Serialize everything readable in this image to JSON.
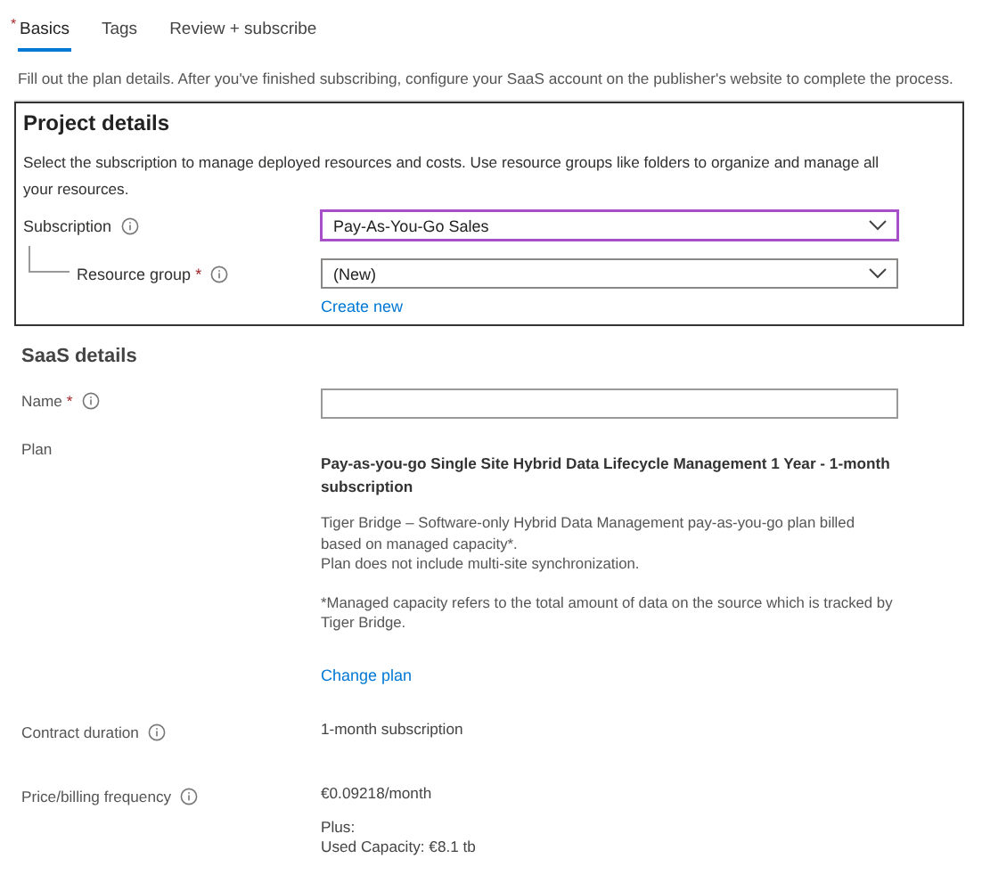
{
  "tabs": [
    {
      "label": "Basics",
      "selected": true,
      "required_mark": "*"
    },
    {
      "label": "Tags",
      "selected": false
    },
    {
      "label": "Review + subscribe",
      "selected": false
    }
  ],
  "intro": "Fill out the plan details. After you've finished subscribing, configure your SaaS account on the publisher's website to complete the process.",
  "project_details": {
    "title": "Project details",
    "description": "Select the subscription to manage deployed resources and costs. Use resource groups like folders to organize and manage all your resources.",
    "fields": [
      {
        "kind": "dropdown",
        "label": "Subscription",
        "info": true,
        "nested": false,
        "value": "Pay-As-You-Go Sales",
        "focused": true
      },
      {
        "kind": "dropdown",
        "label": "Resource group",
        "required_mark": "*",
        "info": true,
        "nested": true,
        "value": "(New)",
        "focused": false,
        "link": "Create new"
      }
    ]
  },
  "saas_details": {
    "title": "SaaS details",
    "fields": [
      {
        "kind": "input",
        "label": "Name",
        "required_mark": "*",
        "info": true
      },
      {
        "kind": "plan",
        "label": "Plan",
        "plan_title": "Pay-as-you-go Single Site Hybrid Data Lifecycle Management 1 Year - 1-month subscription",
        "paragraphs": [
          "Tiger Bridge – Software-only Hybrid Data Management pay-as-you-go plan billed based on managed capacity*.\nPlan does not include multi-site synchronization.",
          "*Managed capacity refers to the total amount of data on the source which is tracked by Tiger Bridge."
        ],
        "link": "Change plan"
      },
      {
        "kind": "text",
        "label": "Contract duration",
        "info": true,
        "lines": [
          "1-month subscription"
        ]
      },
      {
        "kind": "text",
        "label": "Price/billing frequency",
        "info": true,
        "lines": [
          "€0.09218/month",
          "Plus:\nUsed Capacity: €8.1 tb"
        ]
      }
    ]
  }
}
